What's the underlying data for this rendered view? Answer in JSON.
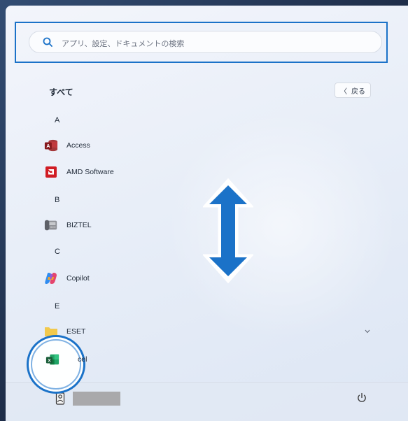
{
  "search": {
    "placeholder": "アプリ、設定、ドキュメントの検索"
  },
  "header": {
    "title": "すべて",
    "back_label": "戻る",
    "back_glyph": "〈"
  },
  "groups": [
    {
      "letter": "A",
      "apps": [
        {
          "label": "Access",
          "icon": "access-icon"
        },
        {
          "label": "AMD Software",
          "icon": "amd-software-icon"
        }
      ]
    },
    {
      "letter": "B",
      "apps": [
        {
          "label": "BIZTEL",
          "icon": "biztel-icon"
        }
      ]
    },
    {
      "letter": "C",
      "apps": [
        {
          "label": "Copilot",
          "icon": "copilot-icon"
        }
      ]
    },
    {
      "letter": "E",
      "apps": [
        {
          "label": "ESET",
          "icon": "folder-icon"
        },
        {
          "label": "cel",
          "icon": "excel-icon"
        }
      ]
    }
  ],
  "footer": {
    "user_icon": "user-avatar-icon",
    "power_icon": "power-icon"
  },
  "colors": {
    "accent": "#1b72c8",
    "panel": "#eef2f9",
    "text": "#1f2937"
  },
  "annotations": {
    "arrow": "vertical-double-arrow",
    "circle": "highlight-circle-excel"
  }
}
